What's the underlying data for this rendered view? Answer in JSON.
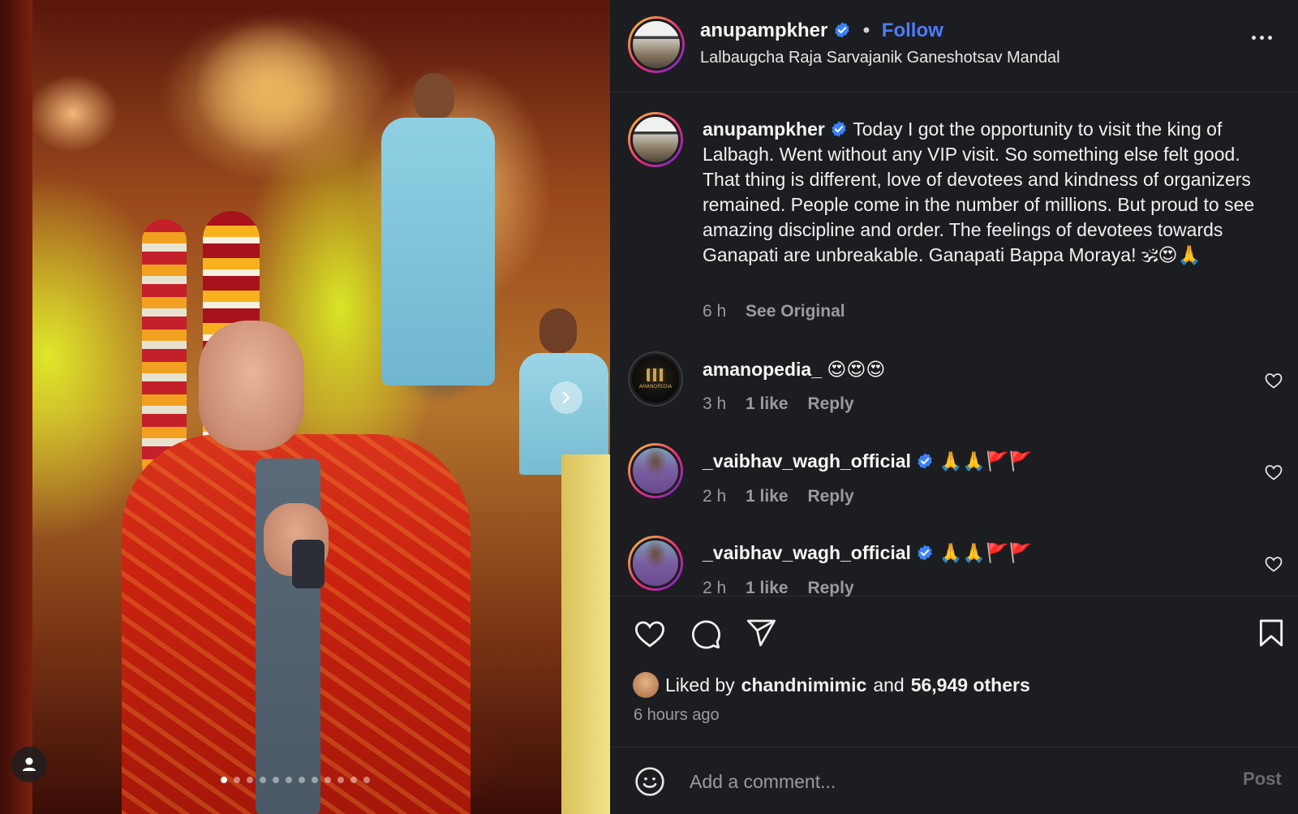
{
  "post": {
    "carousel": {
      "total_slides": 12,
      "active_slide": 1
    }
  },
  "header": {
    "username": "anupampkher",
    "separator": "•",
    "follow_label": "Follow",
    "location": "Lalbaugcha Raja Sarvajanik Ganeshotsav Mandal"
  },
  "caption": {
    "username": "anupampkher",
    "text": "Today I got the opportunity to visit the king of Lalbagh. Went without any VIP visit. So something else felt good. That thing is different, love of devotees and kindness of organizers remained. People come in the number of millions. But proud to see amazing discipline and order. The feelings of devotees towards Ganapati are unbreakable. Ganapati Bappa Moraya! 🕉😍🙏",
    "time": "6 h",
    "see_original": "See Original"
  },
  "comments": [
    {
      "username": "amanopedia_",
      "verified": false,
      "text": "😍😍😍",
      "time": "3 h",
      "likes": "1 like",
      "reply": "Reply",
      "avatar_label": "AMANOPEDIA"
    },
    {
      "username": "_vaibhav_wagh_official",
      "verified": true,
      "text": "🙏🙏🚩🚩",
      "time": "2 h",
      "likes": "1 like",
      "reply": "Reply"
    },
    {
      "username": "_vaibhav_wagh_official",
      "verified": true,
      "text": "🙏🙏🚩🚩",
      "time": "2 h",
      "likes": "1 like",
      "reply": "Reply"
    }
  ],
  "likes": {
    "prefix": "Liked by",
    "user": "chandnimimic",
    "joiner": "and",
    "others": "56,949 others"
  },
  "timestamp": "6 hours ago",
  "add_comment": {
    "placeholder": "Add a comment...",
    "post_label": "Post"
  },
  "colors": {
    "panel_bg": "#1c1d20",
    "follow": "#4f7cff",
    "verified": "#3b82f6",
    "muted": "#9a9b9f"
  },
  "icons": [
    "more-icon",
    "heart-icon",
    "comment-icon",
    "share-icon",
    "bookmark-icon",
    "emoji-icon",
    "chevron-right-icon",
    "user-tag-icon",
    "verified-icon"
  ]
}
